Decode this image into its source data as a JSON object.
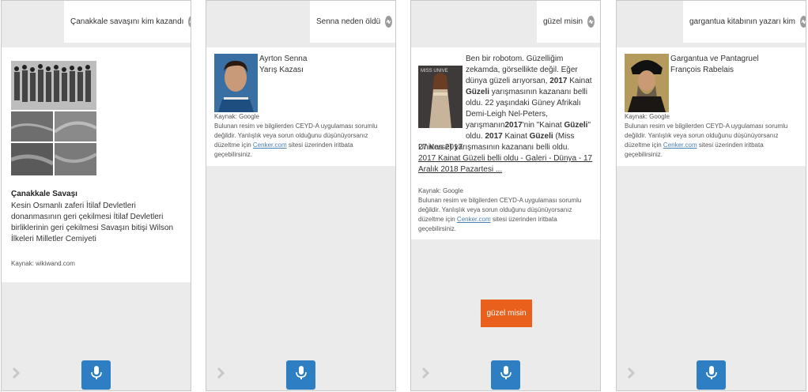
{
  "panels": [
    {
      "query": "Çanakkale savaşını kim kazandı",
      "image_alt": "Çanakkale Savaşı photo collage",
      "title": "Çanakkale Savaşı",
      "body": "Kesin Osmanlı zaferi İtilaf Devletleri donanmasının geri çekilmesi İtilaf Devletleri birliklerinin geri çekilmesi Savaşın bitişi Wilson İlkeleri Milletler Cemiyeti",
      "source": "Kaynak: wikiwand.com"
    },
    {
      "query": "Senna neden öldü",
      "line1": "Ayrton Senna",
      "line2": "Yarış Kazası",
      "source": "Kaynak: Google",
      "disclaimer_pre": "Bulunan resim ve bilgilerden CEYD-A uygulaması sorumlu değildir. Yanlışlık veya sorun olduğunu düşünüyorsanız düzeltme için",
      "disclaimer_link": "Cenker.com",
      "disclaimer_post": "sitesi üzerinden iritbata geçebilirsiniz."
    },
    {
      "query": "güzel misin",
      "answer_intro": "Ben bir robotom. Güzelliğim zekamda, görsellikte değil. Eğer dünya güzeli arıyorsan,",
      "answer_b1": "2017",
      "answer_t1": "Kainat",
      "answer_b2": "Güzeli",
      "answer_t2": "yarışmasının kazananı belli oldu. 22 yaşındaki Güney Afrikalı Demi-Leigh Nel-Peters, yarışmanın",
      "answer_b3": "2017",
      "answer_t3": "'nin \"Kainat",
      "answer_b4": "Güzeli",
      "answer_t4": "\" oldu.",
      "answer_b5": "2017",
      "answer_t5": "Kainat",
      "answer_b6": "Güzeli",
      "answer_t6": "(Miss Universe) yarışmasının kazananı belli oldu.",
      "date": "27 Kas 2017",
      "link": "2017 Kainat Güzeli belli oldu - Galeri - Dünya - 17 Aralık 2018 Pazartesi ...",
      "source": "Kaynak: Google",
      "disclaimer_pre": "Bulunan resim ve bilgilerden CEYD-A uygulaması sorumlu değildir. Yanlışlık veya sorun olduğunu düşünüyorsanız düzeltme için",
      "disclaimer_link": "Cenker.com",
      "disclaimer_post": "sitesi üzerinden iritbata geçebilirsiniz.",
      "bubble": "güzel misin"
    },
    {
      "query": "gargantua kitabının yazarı kim",
      "line1": "Gargantua ve Pantagruel",
      "line2": "François Rabelais",
      "source": "Kaynak: Google",
      "disclaimer_pre": "Bulunan resim ve bilgilerden CEYD-A uygulaması sorumlu değildir. Yanlışlık veya sorun olduğunu düşünüyorsanız düzeltme için",
      "disclaimer_link": "Cenker.com",
      "disclaimer_post": "sitesi üzerinden iritbata geçebilirsiniz."
    }
  ],
  "icons": {
    "swap": "swap-arrows-icon",
    "mic": "microphone-icon",
    "next": "chevron-right-icon"
  },
  "colors": {
    "mic_bg": "#2e7ec4",
    "bubble_bg": "#e8601c",
    "link": "#4a7fb0"
  }
}
